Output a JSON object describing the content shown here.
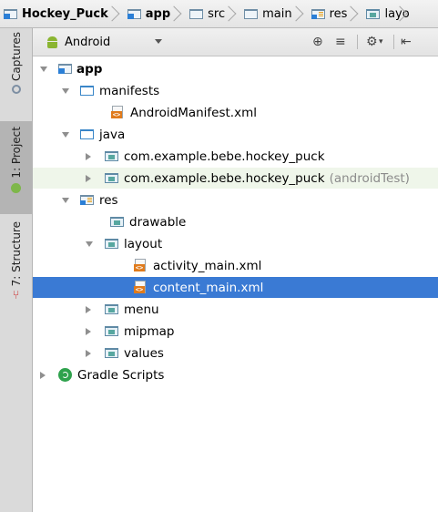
{
  "breadcrumb": {
    "items": [
      {
        "label": "Hockey_Puck",
        "icon": "module-folder-icon"
      },
      {
        "label": "app",
        "icon": "module-folder-icon"
      },
      {
        "label": "src",
        "icon": "folder-icon"
      },
      {
        "label": "main",
        "icon": "folder-icon"
      },
      {
        "label": "res",
        "icon": "resources-folder-icon"
      },
      {
        "label": "layo",
        "icon": "package-folder-icon"
      }
    ]
  },
  "toolstrip": {
    "captures": "Captures",
    "project": "1: Project",
    "structure": "7: Structure"
  },
  "viewbar": {
    "view_label": "Android"
  },
  "tree": {
    "app": "app",
    "manifests": "manifests",
    "android_manifest": "AndroidManifest.xml",
    "java": "java",
    "pkg_main": "com.example.bebe.hockey_puck",
    "pkg_test": "com.example.bebe.hockey_puck",
    "pkg_test_suffix": "(androidTest)",
    "res": "res",
    "drawable": "drawable",
    "layout": "layout",
    "activity_main": "activity_main.xml",
    "content_main": "content_main.xml",
    "menu": "menu",
    "mipmap": "mipmap",
    "values": "values",
    "gradle_scripts": "Gradle Scripts"
  },
  "colors": {
    "selection": "#3a7ad4",
    "android_green": "#8ab531",
    "xml_orange": "#e07b1c"
  }
}
